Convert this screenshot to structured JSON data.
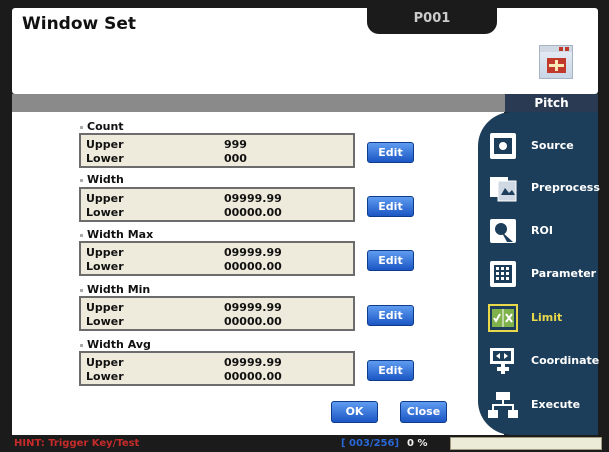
{
  "window": {
    "title": "Window Set",
    "program": "P001"
  },
  "header": {
    "tab_label": "Pitch"
  },
  "groups": [
    {
      "label": "Count",
      "upper_label": "Upper",
      "lower_label": "Lower",
      "upper": "999",
      "lower": "000",
      "edit": "Edit"
    },
    {
      "label": "Width",
      "upper_label": "Upper",
      "lower_label": "Lower",
      "upper": "09999.99",
      "lower": "00000.00",
      "edit": "Edit"
    },
    {
      "label": "Width Max",
      "upper_label": "Upper",
      "lower_label": "Lower",
      "upper": "09999.99",
      "lower": "00000.00",
      "edit": "Edit"
    },
    {
      "label": "Width Min",
      "upper_label": "Upper",
      "lower_label": "Lower",
      "upper": "09999.99",
      "lower": "00000.00",
      "edit": "Edit"
    },
    {
      "label": "Width Avg",
      "upper_label": "Upper",
      "lower_label": "Lower",
      "upper": "09999.99",
      "lower": "00000.00",
      "edit": "Edit"
    }
  ],
  "buttons": {
    "ok": "OK",
    "close": "Close"
  },
  "sidebar": {
    "items": [
      {
        "label": "Source",
        "icon": "source-icon"
      },
      {
        "label": "Preprocess",
        "icon": "preprocess-icon"
      },
      {
        "label": "ROI",
        "icon": "roi-icon"
      },
      {
        "label": "Parameter",
        "icon": "parameter-icon"
      },
      {
        "label": "Limit",
        "icon": "limit-icon",
        "active": true
      },
      {
        "label": "Coordinate",
        "icon": "coordinate-icon"
      },
      {
        "label": "Execute",
        "icon": "execute-icon"
      }
    ]
  },
  "status": {
    "hint": "HINT: Trigger Key/Test",
    "counter": "[ 003/256]",
    "percent": "0 %"
  },
  "colors": {
    "accent": "#1b56c4",
    "sidebar": "#1d3e5a",
    "active": "#e8d84a",
    "hint": "#c62b2b"
  }
}
